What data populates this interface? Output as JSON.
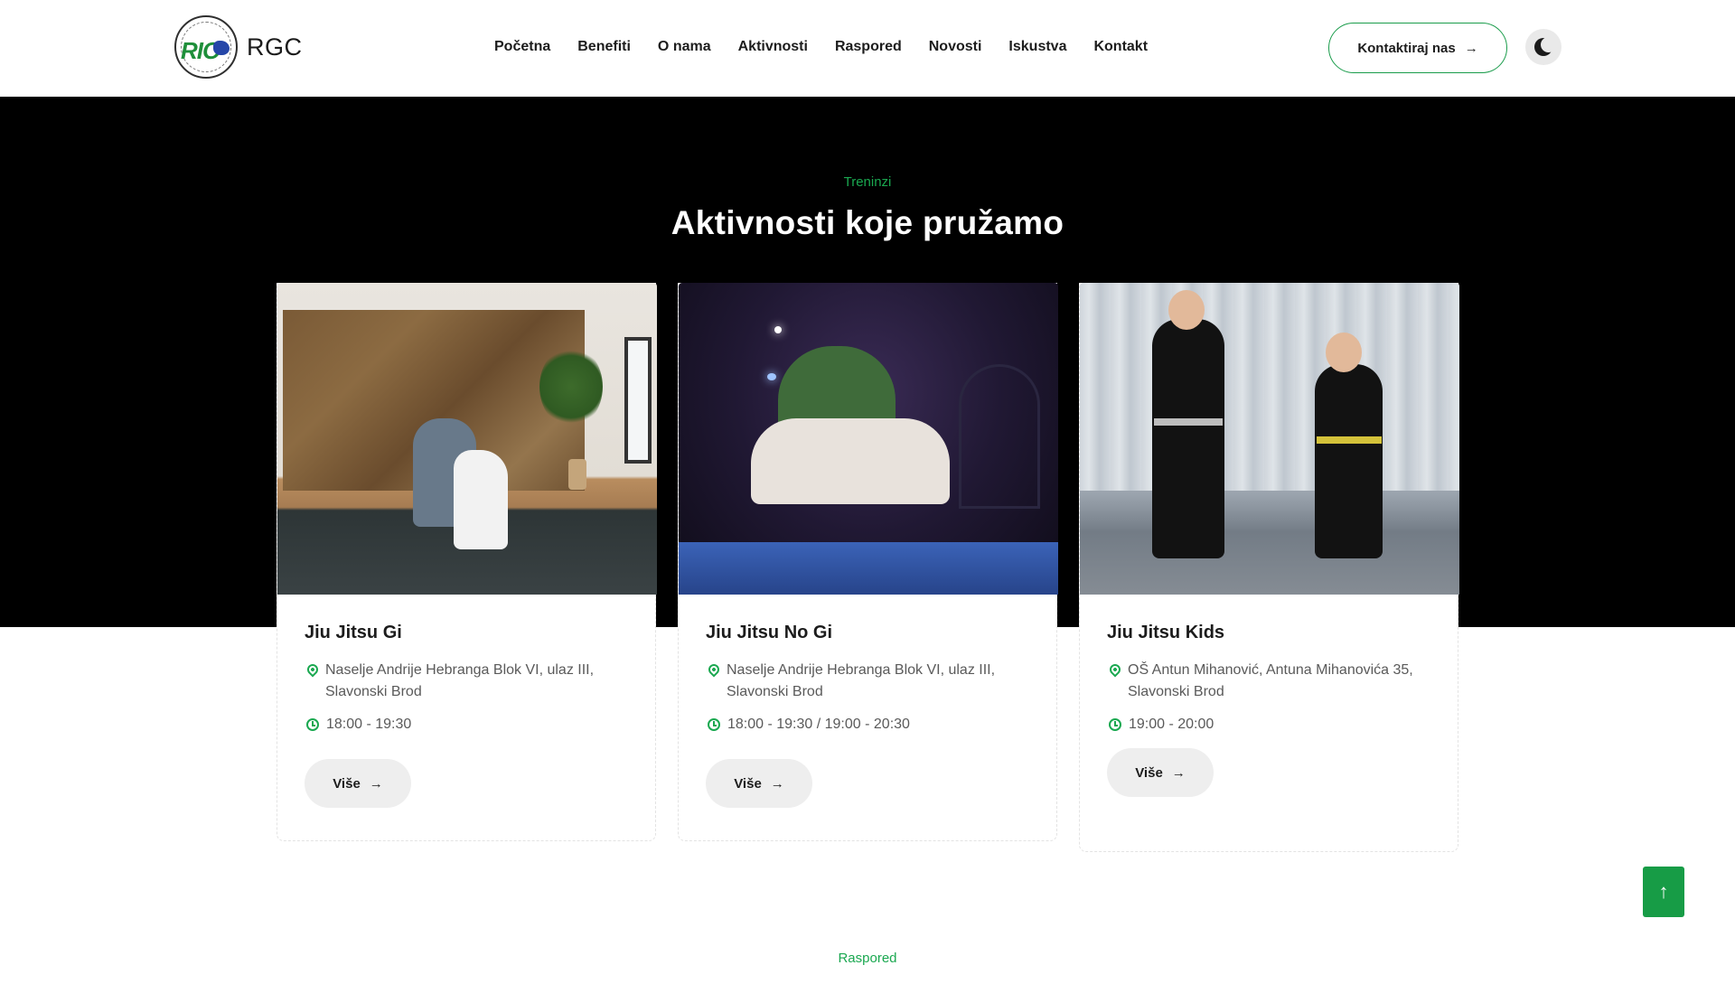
{
  "header": {
    "logo_text": "RGC",
    "logo_badge_text": "RIO",
    "nav": [
      "Početna",
      "Benefiti",
      "O nama",
      "Aktivnosti",
      "Raspored",
      "Novosti",
      "Iskustva",
      "Kontakt"
    ],
    "cta_label": "Kontaktiraj nas",
    "cta_icon": "arrow-right-icon",
    "theme_icon": "moon-icon"
  },
  "activities": {
    "eyebrow": "Treninzi",
    "title": "Aktivnosti koje pružamo",
    "cards": [
      {
        "title": "Jiu Jitsu Gi",
        "location": "Naselje Andrije Hebranga Blok VI, ulaz III, Slavonski Brod",
        "time": "18:00 - 19:30",
        "button": "Više"
      },
      {
        "title": "Jiu Jitsu No Gi",
        "location": "Naselje Andrije Hebranga Blok VI, ulaz III, Slavonski Brod",
        "time": "18:00 - 19:30 / 19:00 - 20:30",
        "button": "Više"
      },
      {
        "title": "Jiu Jitsu Kids",
        "location": "OŠ Antun Mihanović, Antuna Mihanovića 35, Slavonski Brod",
        "time": "19:00 - 20:00",
        "button": "Više"
      }
    ]
  },
  "schedule": {
    "eyebrow": "Raspored"
  },
  "colors": {
    "accent": "#1aa850",
    "dark": "#000000",
    "to_top_bg": "#179c46"
  }
}
